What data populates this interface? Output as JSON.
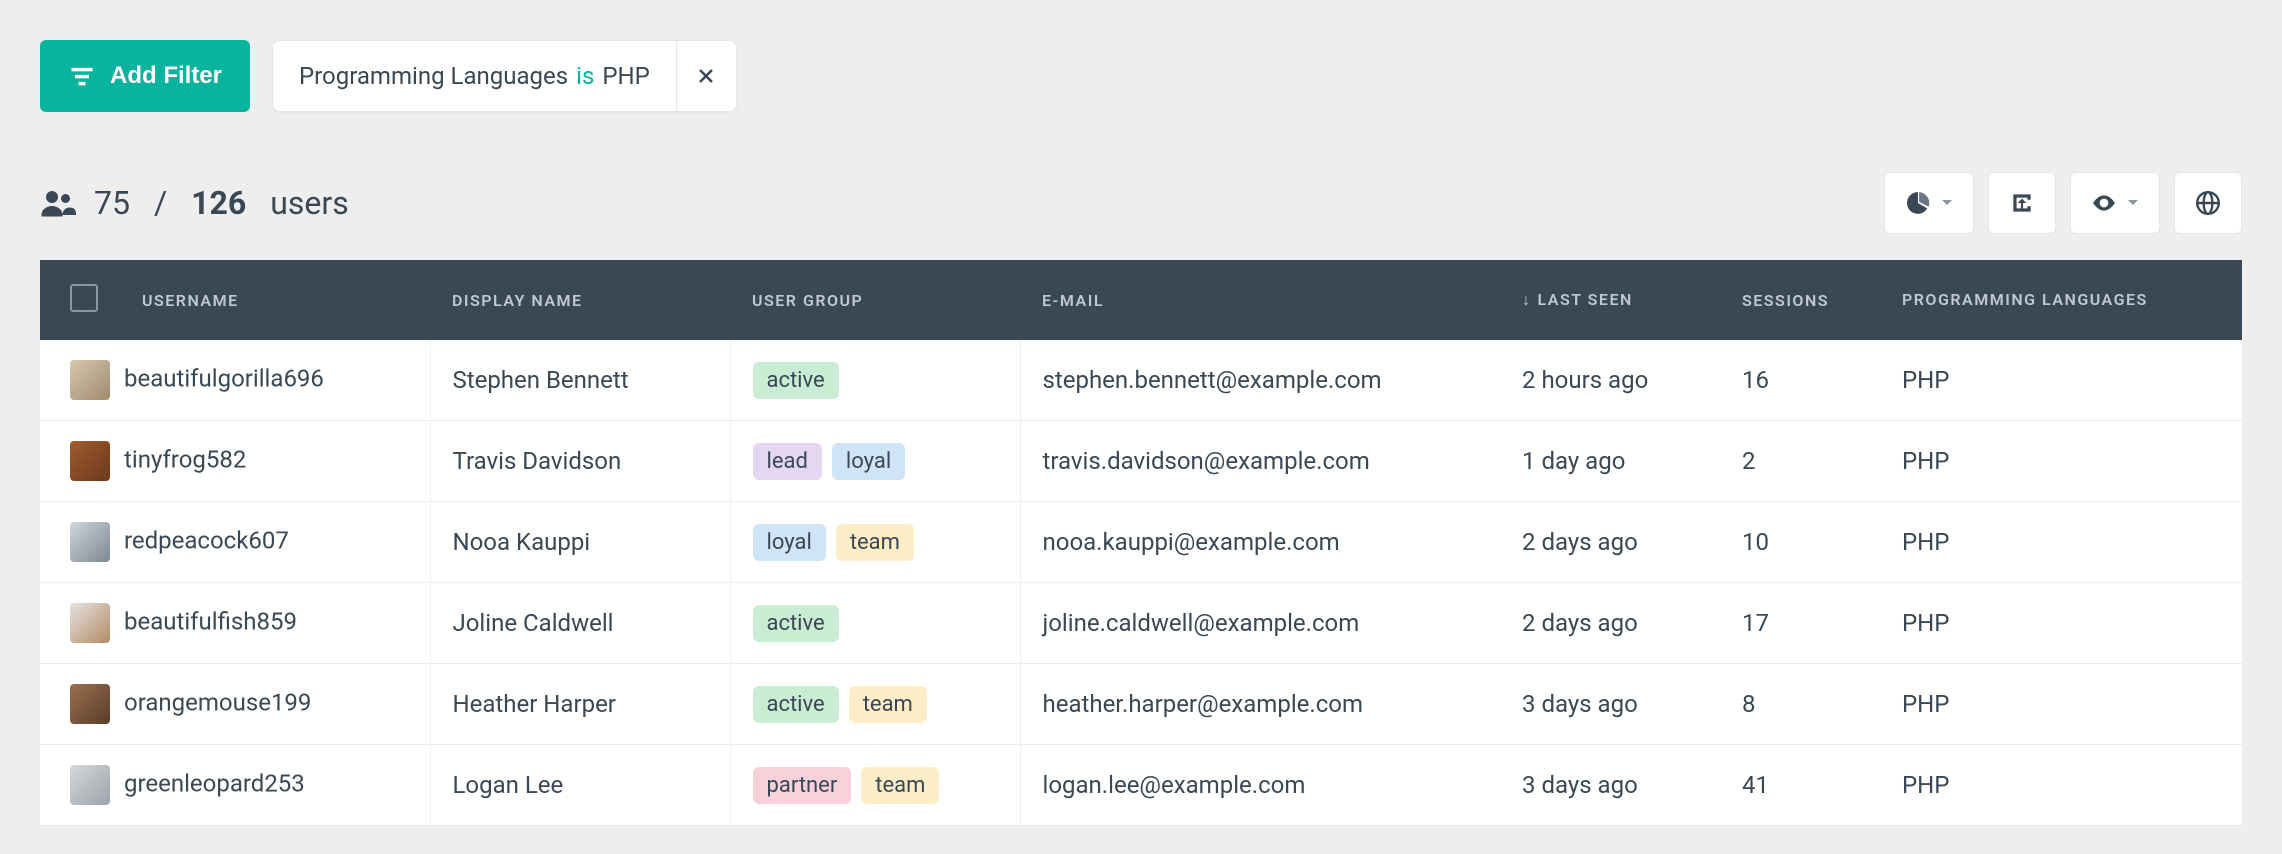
{
  "toolbar": {
    "add_filter_label": "Add Filter",
    "filter_chip": {
      "field": "Programming Languages",
      "operator": "is",
      "value": "PHP"
    }
  },
  "summary": {
    "shown": "75",
    "separator": "/",
    "total": "126",
    "noun": "users"
  },
  "table": {
    "headers": {
      "username": "USERNAME",
      "display_name": "DISPLAY NAME",
      "user_group": "USER GROUP",
      "email": "E-MAIL",
      "last_seen": "LAST SEEN",
      "sessions": "SESSIONS",
      "languages": "PROGRAMMING LANGUAGES",
      "sort_indicator": "↓"
    },
    "rows": [
      {
        "username": "beautifulgorilla696",
        "display_name": "Stephen Bennett",
        "groups": [
          "active"
        ],
        "email": "stephen.bennett@example.com",
        "last_seen": "2 hours ago",
        "sessions": "16",
        "languages": "PHP"
      },
      {
        "username": "tinyfrog582",
        "display_name": "Travis Davidson",
        "groups": [
          "lead",
          "loyal"
        ],
        "email": "travis.davidson@example.com",
        "last_seen": "1 day ago",
        "sessions": "2",
        "languages": "PHP"
      },
      {
        "username": "redpeacock607",
        "display_name": "Nooa Kauppi",
        "groups": [
          "loyal",
          "team"
        ],
        "email": "nooa.kauppi@example.com",
        "last_seen": "2 days ago",
        "sessions": "10",
        "languages": "PHP"
      },
      {
        "username": "beautifulfish859",
        "display_name": "Joline Caldwell",
        "groups": [
          "active"
        ],
        "email": "joline.caldwell@example.com",
        "last_seen": "2 days ago",
        "sessions": "17",
        "languages": "PHP"
      },
      {
        "username": "orangemouse199",
        "display_name": "Heather Harper",
        "groups": [
          "active",
          "team"
        ],
        "email": "heather.harper@example.com",
        "last_seen": "3 days ago",
        "sessions": "8",
        "languages": "PHP"
      },
      {
        "username": "greenleopard253",
        "display_name": "Logan Lee",
        "groups": [
          "partner",
          "team"
        ],
        "email": "logan.lee@example.com",
        "last_seen": "3 days ago",
        "sessions": "41",
        "languages": "PHP"
      }
    ]
  }
}
